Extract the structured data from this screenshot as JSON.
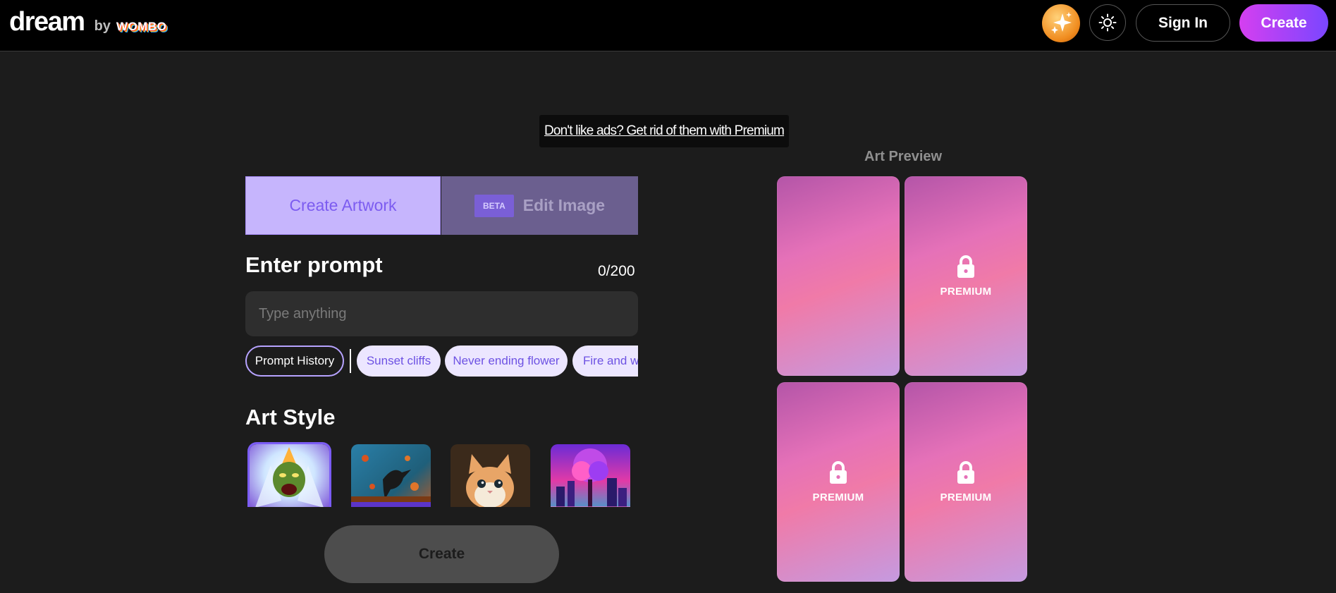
{
  "header": {
    "logo_dream": "dream",
    "logo_by": "by",
    "logo_wombo": "WOMBO",
    "signin_label": "Sign In",
    "create_label": "Create"
  },
  "ad": {
    "text": "Don't like ads? Get rid of them with Premium"
  },
  "tabs": {
    "create_artwork": "Create Artwork",
    "beta_badge": "BETA",
    "edit_image": "Edit Image"
  },
  "prompt": {
    "title": "Enter prompt",
    "char_count": "0/200",
    "placeholder": "Type anything",
    "value": ""
  },
  "chips": {
    "history": "Prompt History",
    "suggestions": [
      "Sunset cliffs",
      "Never ending flower",
      "Fire and water"
    ]
  },
  "art_style": {
    "title": "Art Style"
  },
  "create_button": "Create",
  "preview": {
    "title": "Art Preview",
    "premium_label": "PREMIUM"
  },
  "colors": {
    "accent": "#7c5cf0",
    "tab_active_bg": "#c6b5fd",
    "tab_inactive_bg": "#6b5f8f",
    "create_gradient_start": "#d53ff0",
    "create_gradient_end": "#7a46ff"
  },
  "icons": [
    "sparkle-icon",
    "sun-icon",
    "lock-icon"
  ]
}
